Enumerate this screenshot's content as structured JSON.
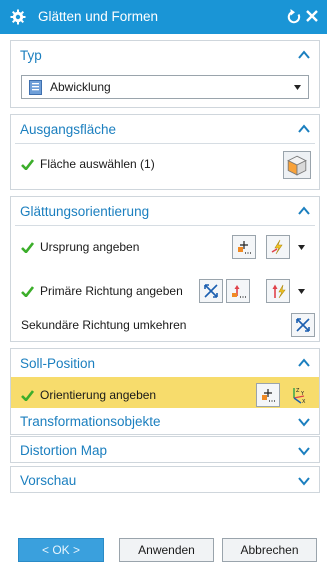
{
  "window": {
    "title": "Glätten und Formen"
  },
  "sections": {
    "typ": {
      "title": "Typ",
      "dropdown_value": "Abwicklung"
    },
    "ausgangsflaeche": {
      "title": "Ausgangsfläche",
      "row_label": "Fläche auswählen (1)"
    },
    "glaettung": {
      "title": "Glättungsorientierung",
      "rows": [
        "Ursprung angeben",
        "Primäre Richtung angeben",
        "Sekundäre Richtung umkehren"
      ]
    },
    "soll": {
      "title": "Soll-Position",
      "row_label": "Orientierung angeben"
    },
    "transformation": {
      "title": "Transformationsobjekte"
    },
    "distortion": {
      "title": "Distortion Map"
    },
    "vorschau": {
      "title": "Vorschau"
    }
  },
  "buttons": {
    "ok": "< OK >",
    "apply": "Anwenden",
    "cancel": "Abbrechen"
  },
  "colors": {
    "titlebar": "#1a95d6",
    "section_title": "#1b7fbf",
    "highlight": "#f7dc6c",
    "check": "#3cae2b"
  }
}
